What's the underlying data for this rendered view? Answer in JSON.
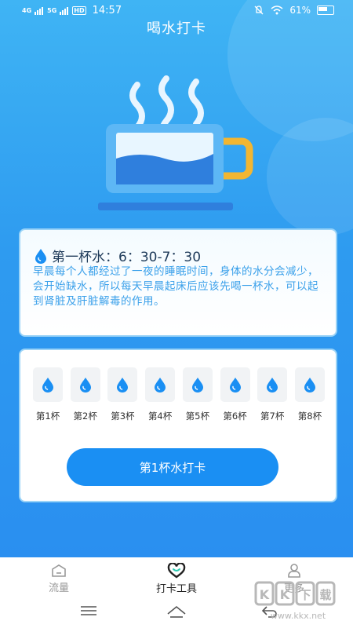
{
  "status_bar": {
    "signal1": "4G",
    "signal2": "5G",
    "hd": "HD",
    "time": "14:57",
    "battery": "61%"
  },
  "page": {
    "title": "喝水打卡"
  },
  "colors": {
    "primary": "#1a8ff3",
    "accent": "#3aa0ea",
    "cup_handle": "#f2b632"
  },
  "info_card": {
    "icon": "water-drop-icon",
    "title": "第一杯水：6：30-7：30",
    "text": "早晨每个人都经过了一夜的睡眠时间，身体的水分会减少，会开始缺水，所以每天早晨起床后应该先喝一杯水，可以起到肾脏及肝脏解毒的作用。"
  },
  "checkin": {
    "cups": [
      {
        "label": "第1杯",
        "icon": "water-drop-icon"
      },
      {
        "label": "第2杯",
        "icon": "water-drop-icon"
      },
      {
        "label": "第3杯",
        "icon": "water-drop-icon"
      },
      {
        "label": "第4杯",
        "icon": "water-drop-icon"
      },
      {
        "label": "第5杯",
        "icon": "water-drop-icon"
      },
      {
        "label": "第6杯",
        "icon": "water-drop-icon"
      },
      {
        "label": "第7杯",
        "icon": "water-drop-icon"
      },
      {
        "label": "第8杯",
        "icon": "water-drop-icon"
      }
    ],
    "button_label": "第1杯水打卡"
  },
  "bottom_nav": {
    "items": [
      {
        "label": "流量",
        "icon": "home-icon"
      },
      {
        "label": "打卡工具",
        "icon": "heart-icon"
      },
      {
        "label": "更多",
        "icon": "person-icon"
      }
    ],
    "active_index": 1
  },
  "watermark": {
    "text": "KK下载",
    "url": "www.kkx.net"
  }
}
